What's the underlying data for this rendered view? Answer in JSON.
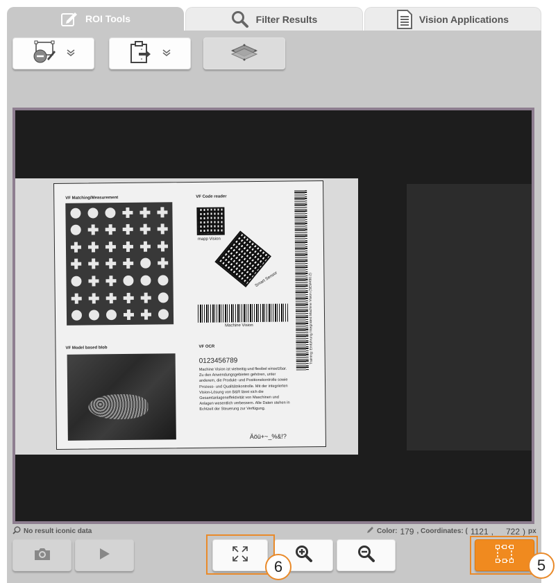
{
  "tabs": [
    {
      "label": "ROI Tools",
      "icon": "edit-icon",
      "active": true
    },
    {
      "label": "Filter Results",
      "icon": "search-icon",
      "active": false
    },
    {
      "label": "Vision Applications",
      "icon": "document-icon",
      "active": false
    }
  ],
  "toolbar": {
    "buttons": [
      {
        "icon": "roi-shape-edit-icon",
        "has_dropdown": true
      },
      {
        "icon": "clipboard-paste-icon",
        "has_dropdown": true
      },
      {
        "icon": "layers-icon",
        "has_dropdown": false,
        "disabled": true
      }
    ]
  },
  "image": {
    "sections": {
      "matching": "VF Matching/Measurement",
      "code_reader": "VF Code reader",
      "blob": "VF Model based blob",
      "ocr": "VF OCR"
    },
    "mapp_vision": "mapp Vision",
    "smart_sensor": "Smart Sensor",
    "machine_vision": "Machine Vision",
    "ocr_number": "0123456789",
    "ocr_text": "Machine Vision ist vielseitig und flexibel einsetzbar. Zu den Anwendungsgebieten gehören, unter anderem, die Produkt- und Positionskontrolle sowie Prozess- und Qualitätskontrolle. Mit der integrierten Vision-Lösung von B&R lässt sich die Gesamtanlageneffektivität von Maschinen und Anlagen wesentlich verbessern. Alle Daten stehen in Echtzeit der Steuerung zur Verfügung.",
    "ocr_special": "Äöü+~_%&!?",
    "vertical_text": "Training: Einführung Integrated Machine Vision (SEM490.2)",
    "grid_pattern": [
      [
        "dot",
        "dot",
        "dot",
        "cross",
        "cross",
        "cross"
      ],
      [
        "dot",
        "cross",
        "cross",
        "cross",
        "cross",
        "cross"
      ],
      [
        "cross",
        "cross",
        "cross",
        "cross",
        "cross",
        "cross"
      ],
      [
        "cross",
        "cross",
        "cross",
        "cross",
        "dot",
        "cross"
      ],
      [
        "dot",
        "cross",
        "cross",
        "dot",
        "dot",
        "dot"
      ],
      [
        "cross",
        "cross",
        "cross",
        "cross",
        "cross",
        "dot"
      ],
      [
        "dot",
        "dot",
        "dot",
        "cross",
        "cross",
        "dot"
      ]
    ]
  },
  "status": {
    "left": "No result iconic data",
    "color_label": "Color:",
    "color_value": "179",
    "coords_label": ", Coordinates: (",
    "coord_x": "1121",
    "coord_sep": ",",
    "coord_y": "722",
    "coords_close": ")",
    "unit": "px"
  },
  "bottom": {
    "buttons": [
      {
        "icon": "camera-icon",
        "disabled": true
      },
      {
        "icon": "play-icon",
        "disabled": true
      },
      {
        "icon": "fit-to-window-icon"
      },
      {
        "icon": "zoom-in-icon"
      },
      {
        "icon": "zoom-out-icon"
      },
      {
        "icon": "roi-rectangle-icon",
        "active": true
      }
    ],
    "callouts": [
      "6",
      "5"
    ]
  },
  "colors": {
    "accent": "#f08a1f",
    "viewer_border": "#8e7e90",
    "panel": "#c8c8c8"
  }
}
